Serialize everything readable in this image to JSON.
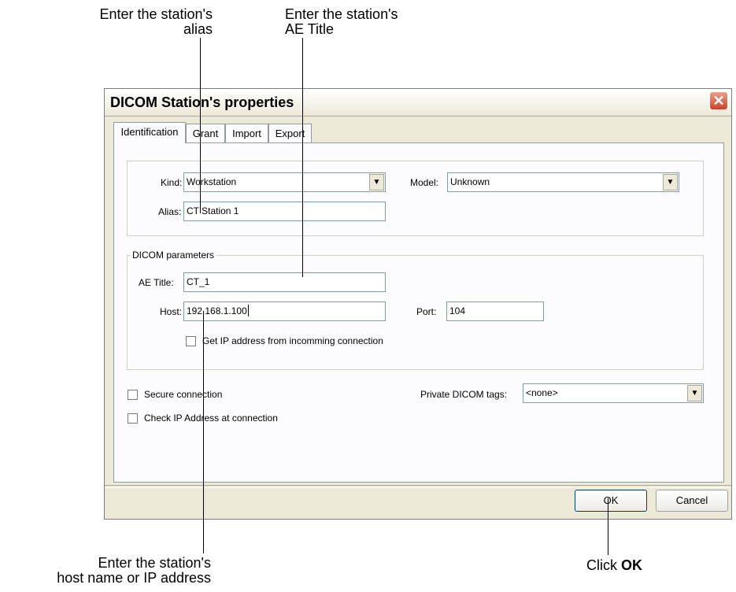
{
  "callouts": {
    "alias_line1": "Enter the station's",
    "alias_line2": "alias",
    "aetitle_line1": "Enter the station's",
    "aetitle_line2": "AE Title",
    "host_line1": "Enter the station's",
    "host_line2": "host name or IP address",
    "ok_prefix": "Click ",
    "ok_bold": "OK"
  },
  "dialog": {
    "title": "DICOM Station's properties",
    "close_glyph": "✕",
    "tabs": [
      {
        "label": "Identification",
        "active": true
      },
      {
        "label": "Grant",
        "active": false
      },
      {
        "label": "Import",
        "active": false
      },
      {
        "label": "Export",
        "active": false
      }
    ],
    "kind": {
      "label": "Kind:",
      "value": "Workstation"
    },
    "model": {
      "label": "Model:",
      "value": "Unknown"
    },
    "alias": {
      "label": "Alias:",
      "value": "CT Station 1"
    },
    "dicom_group": {
      "legend": "DICOM parameters"
    },
    "ae_title": {
      "label": "AE Title:",
      "value": "CT_1"
    },
    "host": {
      "label": "Host:",
      "value": "192.168.1.100"
    },
    "port": {
      "label": "Port:",
      "value": "104"
    },
    "get_ip": {
      "label": "Get IP address from incomming connection",
      "checked": false
    },
    "secure": {
      "label": "Secure connection",
      "checked": false
    },
    "check_ip": {
      "label": "Check IP Address at connection",
      "checked": false
    },
    "private_tags": {
      "label": "Private DICOM tags:",
      "value": "<none>"
    },
    "ok_label": "OK",
    "cancel_label": "Cancel",
    "dropdown_glyph": "▼"
  }
}
